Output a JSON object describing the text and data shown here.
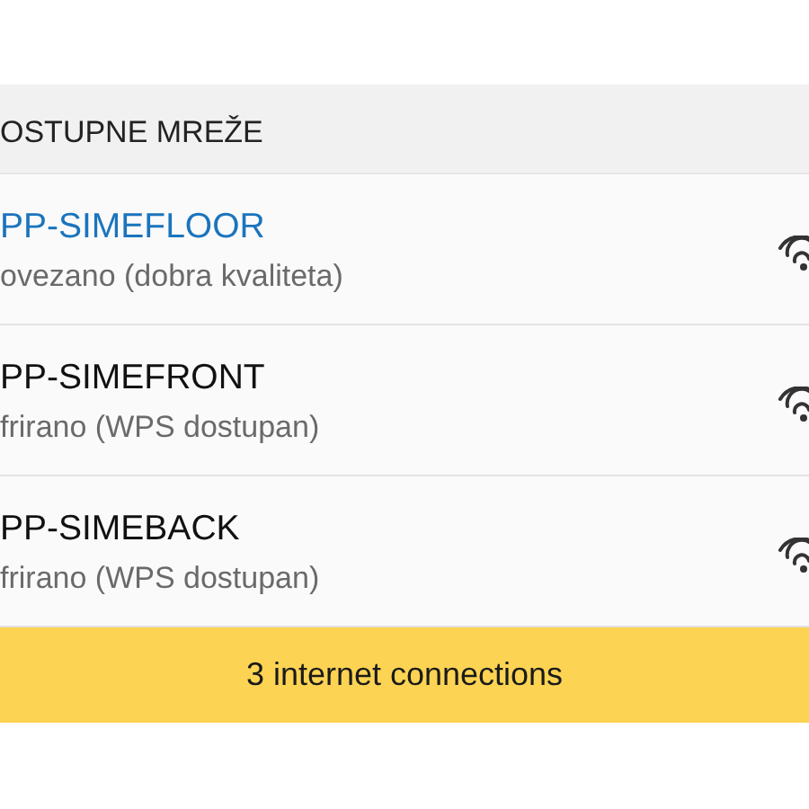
{
  "section_title": "OSTUPNE MREŽE",
  "networks": [
    {
      "name": "PP-SIMEFLOOR",
      "status": "ovezano (dobra kvaliteta)",
      "connected": true
    },
    {
      "name": "PP-SIMEFRONT",
      "status": "frirano (WPS dostupan)",
      "connected": false
    },
    {
      "name": "PP-SIMEBACK",
      "status": "frirano (WPS dostupan)",
      "connected": false
    }
  ],
  "banner": "3 internet connections"
}
